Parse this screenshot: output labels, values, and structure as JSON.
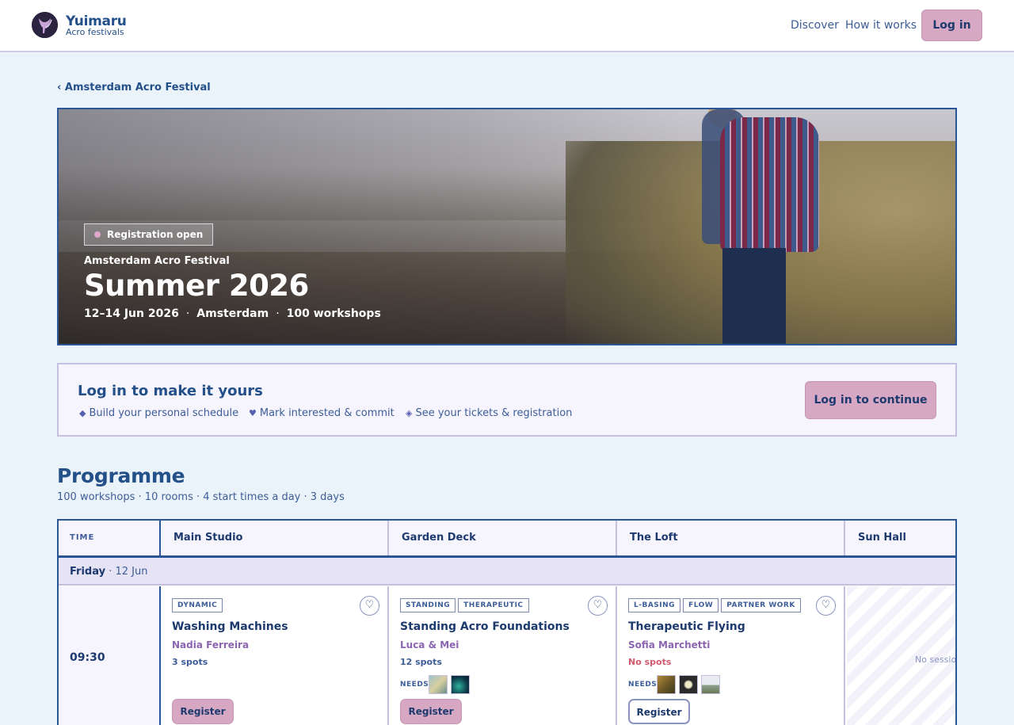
{
  "header": {
    "brand_name": "Yuimaru",
    "brand_sub": "Acro festivals",
    "nav": [
      "Discover",
      "How it works"
    ],
    "login_label": "Log in"
  },
  "breadcrumb": {
    "back_label": "‹ Amsterdam Acro Festival"
  },
  "hero": {
    "badge": "Registration open",
    "kicker": "Amsterdam Acro Festival",
    "title": "Summer 2026",
    "meta": [
      "12–14 Jun 2026",
      "Amsterdam",
      "100 workshops"
    ],
    "meta_sep": "·"
  },
  "promo": {
    "title": "Log in to make it yours",
    "features": [
      {
        "icon": "◆",
        "icon_name": "diamond-icon",
        "text": "Build your personal schedule"
      },
      {
        "icon": "♥",
        "icon_name": "heart-icon",
        "text": "Mark interested & commit"
      },
      {
        "icon": "◈",
        "icon_name": "ticket-icon",
        "text": "See your tickets & registration"
      }
    ],
    "button": "Log in to continue"
  },
  "programme": {
    "title": "Programme",
    "subtitle": "100 workshops · 10 rooms · 4 start times a day · 3 days",
    "columns": [
      "TIME",
      "Main Studio",
      "Garden Deck",
      "The Loft",
      "Sun Hall"
    ],
    "day": {
      "name": "Friday",
      "date": "· 12 Jun"
    },
    "slot_time": "09:30",
    "needs_label": "NEEDS",
    "workshops": [
      {
        "tags": [
          "DYNAMIC"
        ],
        "title": "Washing Machines",
        "teacher": "Nadia Ferreira",
        "spots": "3 spots",
        "button": "Register"
      },
      {
        "tags": [
          "STANDING",
          "THERAPEUTIC"
        ],
        "title": "Standing Acro Foundations",
        "teacher": "Luca & Mei",
        "spots": "12 spots",
        "button": "Register"
      },
      {
        "tags": [
          "L-BASING",
          "FLOW",
          "PARTNER WORK"
        ],
        "title": "Therapeutic Flying",
        "teacher": "Sofia Marchetti",
        "spots": "No spots",
        "button": "Register"
      }
    ],
    "empty_text": "No sessions"
  },
  "colors": {
    "accent": "#d6a8c3",
    "primary": "#24508a",
    "background": "#eaf2fa",
    "no_spots": "#d05a6e"
  }
}
